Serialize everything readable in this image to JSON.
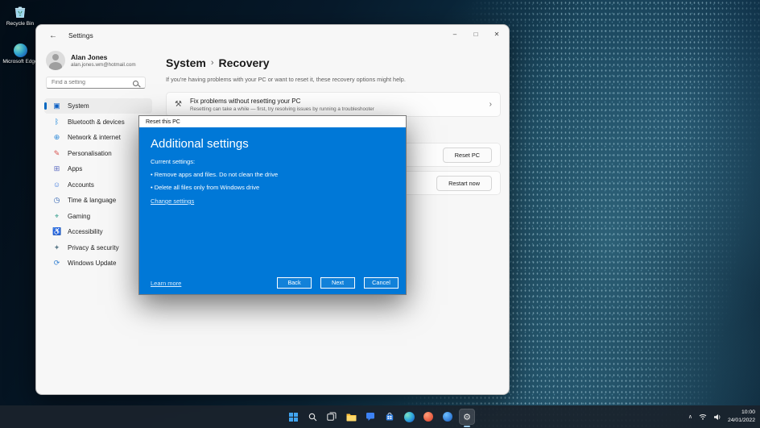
{
  "colors": {
    "accent": "#0067c0",
    "dialog_blue": "#0078d7",
    "taskbar_bg": "#1a222c"
  },
  "desktop": {
    "icons": [
      {
        "label": "Recycle Bin"
      },
      {
        "label": "Microsoft Edge"
      }
    ]
  },
  "settings_window": {
    "titlebar": {
      "back_glyph": "←",
      "title": "Settings",
      "minimize": "–",
      "maximize": "□",
      "close": "✕"
    },
    "sidebar": {
      "user": {
        "name": "Alan Jones",
        "email": "alan.jones.wm@hotmail.com"
      },
      "search_placeholder": "Find a setting",
      "items": [
        {
          "label": "System",
          "icon": "▣"
        },
        {
          "label": "Bluetooth & devices",
          "icon": "ᛒ"
        },
        {
          "label": "Network & internet",
          "icon": "⊕"
        },
        {
          "label": "Personalisation",
          "icon": "✎"
        },
        {
          "label": "Apps",
          "icon": "⊞"
        },
        {
          "label": "Accounts",
          "icon": "☺"
        },
        {
          "label": "Time & language",
          "icon": "◷"
        },
        {
          "label": "Gaming",
          "icon": "⌖"
        },
        {
          "label": "Accessibility",
          "icon": "♿"
        },
        {
          "label": "Privacy & security",
          "icon": "✦"
        },
        {
          "label": "Windows Update",
          "icon": "⟳"
        }
      ]
    },
    "main": {
      "breadcrumb_root": "System",
      "breadcrumb_separator": "›",
      "page_title": "Recovery",
      "subtitle": "If you're having problems with your PC or want to reset it, these recovery options might help.",
      "fix_card": {
        "icon": "⚒",
        "title": "Fix problems without resetting your PC",
        "subtitle": "Resetting can take a while — first, try resolving issues by running a troubleshooter",
        "chevron": "›"
      },
      "reset_button": "Reset PC",
      "restart_button": "Restart now"
    }
  },
  "dialog": {
    "title": "Reset this PC",
    "heading": "Additional settings",
    "current_settings_label": "Current settings:",
    "settings_list": [
      "• Remove apps and files. Do not clean the drive",
      "• Delete all files only from Windows drive"
    ],
    "change_settings_link": "Change settings",
    "learn_more_link": "Learn more",
    "back_button": "Back",
    "next_button": "Next",
    "cancel_button": "Cancel"
  },
  "taskbar": {
    "gear_glyph": "⚙",
    "tray": {
      "chevron": "∧",
      "time": "10:00",
      "date": "24/01/2022"
    }
  }
}
